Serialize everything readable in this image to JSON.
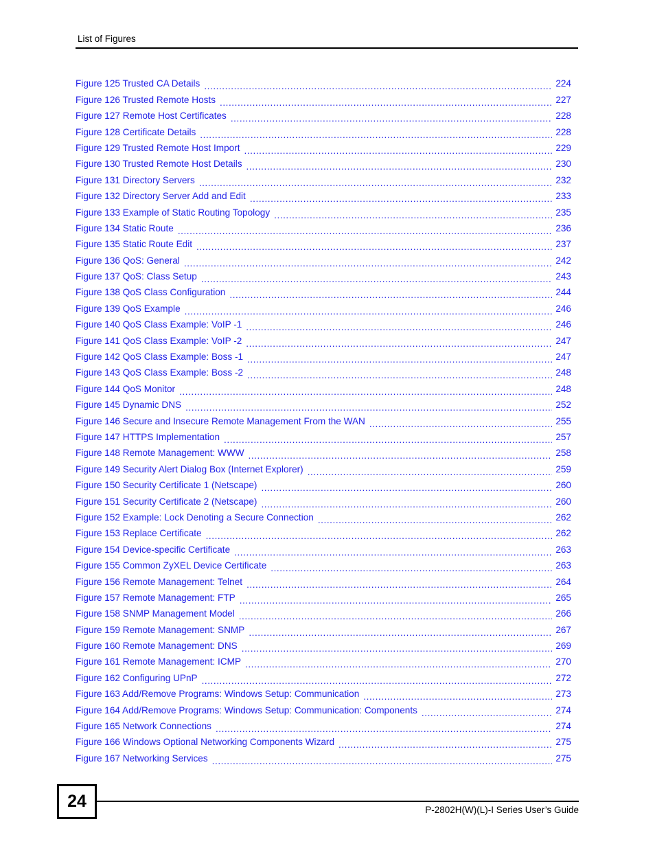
{
  "header": {
    "title": "List of Figures"
  },
  "figure_list": [
    {
      "label": "Figure 125 Trusted CA Details",
      "page": "224"
    },
    {
      "label": "Figure 126 Trusted Remote Hosts",
      "page": "227"
    },
    {
      "label": "Figure 127 Remote Host Certificates",
      "page": "228"
    },
    {
      "label": "Figure 128 Certificate Details",
      "page": "228"
    },
    {
      "label": "Figure 129 Trusted Remote Host Import",
      "page": "229"
    },
    {
      "label": "Figure 130 Trusted Remote Host Details",
      "page": "230"
    },
    {
      "label": "Figure 131 Directory Servers",
      "page": "232"
    },
    {
      "label": "Figure 132 Directory Server Add and Edit",
      "page": "233"
    },
    {
      "label": "Figure 133 Example of Static Routing Topology",
      "page": "235"
    },
    {
      "label": "Figure 134 Static Route",
      "page": "236"
    },
    {
      "label": "Figure 135 Static Route Edit",
      "page": "237"
    },
    {
      "label": "Figure 136 QoS: General",
      "page": "242"
    },
    {
      "label": "Figure 137 QoS: Class Setup",
      "page": "243"
    },
    {
      "label": "Figure 138 QoS Class Configuration",
      "page": "244"
    },
    {
      "label": "Figure 139 QoS Example",
      "page": "246"
    },
    {
      "label": "Figure 140 QoS Class Example: VoIP -1",
      "page": "246"
    },
    {
      "label": "Figure 141 QoS Class Example: VoIP -2",
      "page": "247"
    },
    {
      "label": "Figure 142 QoS Class Example: Boss -1",
      "page": "247"
    },
    {
      "label": "Figure 143 QoS Class Example: Boss -2",
      "page": "248"
    },
    {
      "label": "Figure 144 QoS Monitor",
      "page": "248"
    },
    {
      "label": "Figure 145 Dynamic DNS",
      "page": "252"
    },
    {
      "label": "Figure 146 Secure and Insecure Remote Management From the WAN",
      "page": "255"
    },
    {
      "label": "Figure 147 HTTPS Implementation",
      "page": "257"
    },
    {
      "label": "Figure 148 Remote Management: WWW",
      "page": "258"
    },
    {
      "label": "Figure 149 Security Alert Dialog Box (Internet Explorer)",
      "page": "259"
    },
    {
      "label": "Figure 150 Security Certificate 1 (Netscape)",
      "page": "260"
    },
    {
      "label": "Figure 151 Security Certificate 2 (Netscape)",
      "page": "260"
    },
    {
      "label": "Figure 152 Example: Lock Denoting a Secure Connection",
      "page": "262"
    },
    {
      "label": "Figure 153 Replace Certificate",
      "page": "262"
    },
    {
      "label": "Figure 154 Device-specific Certificate",
      "page": "263"
    },
    {
      "label": "Figure 155 Common ZyXEL Device Certificate",
      "page": "263"
    },
    {
      "label": "Figure 156 Remote Management: Telnet",
      "page": "264"
    },
    {
      "label": "Figure 157 Remote Management: FTP",
      "page": "265"
    },
    {
      "label": "Figure 158 SNMP Management Model",
      "page": "266"
    },
    {
      "label": "Figure 159 Remote Management: SNMP",
      "page": "267"
    },
    {
      "label": "Figure 160 Remote Management: DNS",
      "page": "269"
    },
    {
      "label": "Figure 161 Remote Management: ICMP",
      "page": "270"
    },
    {
      "label": "Figure 162 Configuring UPnP",
      "page": "272"
    },
    {
      "label": "Figure 163 Add/Remove Programs: Windows Setup: Communication",
      "page": "273"
    },
    {
      "label": "Figure 164 Add/Remove Programs: Windows Setup: Communication: Components",
      "page": "274"
    },
    {
      "label": "Figure 165 Network Connections",
      "page": "274"
    },
    {
      "label": "Figure 166 Windows Optional Networking Components Wizard",
      "page": "275"
    },
    {
      "label": "Figure 167 Networking Services",
      "page": "275"
    }
  ],
  "footer": {
    "page_number": "24",
    "guide_title": "P-2802H(W)(L)-I Series User’s Guide"
  },
  "colors": {
    "link_blue": "#2323E8",
    "text_black": "#000000"
  }
}
